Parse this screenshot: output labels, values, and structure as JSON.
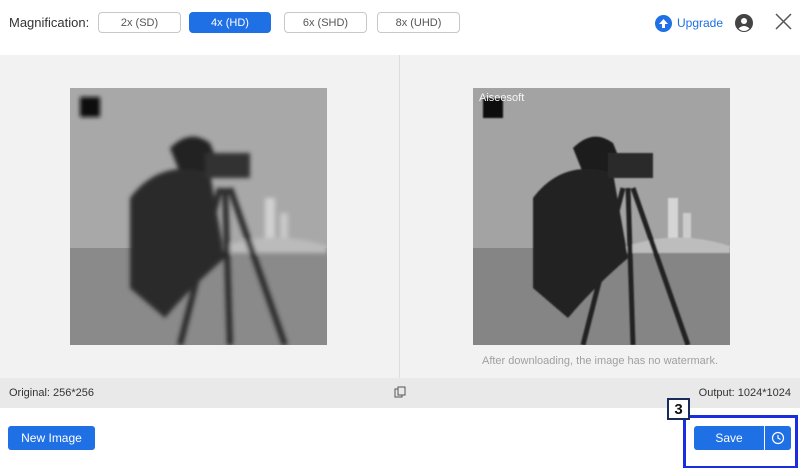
{
  "toolbar": {
    "magnification_label": "Magnification:",
    "options": [
      {
        "label": "2x (SD)",
        "active": false
      },
      {
        "label": "4x (HD)",
        "active": true
      },
      {
        "label": "6x (SHD)",
        "active": false
      },
      {
        "label": "8x (UHD)",
        "active": false
      }
    ],
    "upgrade_label": "Upgrade"
  },
  "preview": {
    "watermark_text": "Aiseesoft",
    "no_watermark_note": "After downloading, the image has no watermark."
  },
  "infobar": {
    "original": "Original: 256*256",
    "output": "Output: 1024*1024"
  },
  "footer": {
    "new_image_label": "New Image",
    "save_label": "Save",
    "step_badge": "3"
  },
  "colors": {
    "accent": "#1f6fe5",
    "highlight_border": "#1a2de0"
  },
  "icons": [
    "upgrade-arrow-icon",
    "user-avatar-icon",
    "close-icon",
    "compare-icon",
    "history-clock-icon"
  ]
}
